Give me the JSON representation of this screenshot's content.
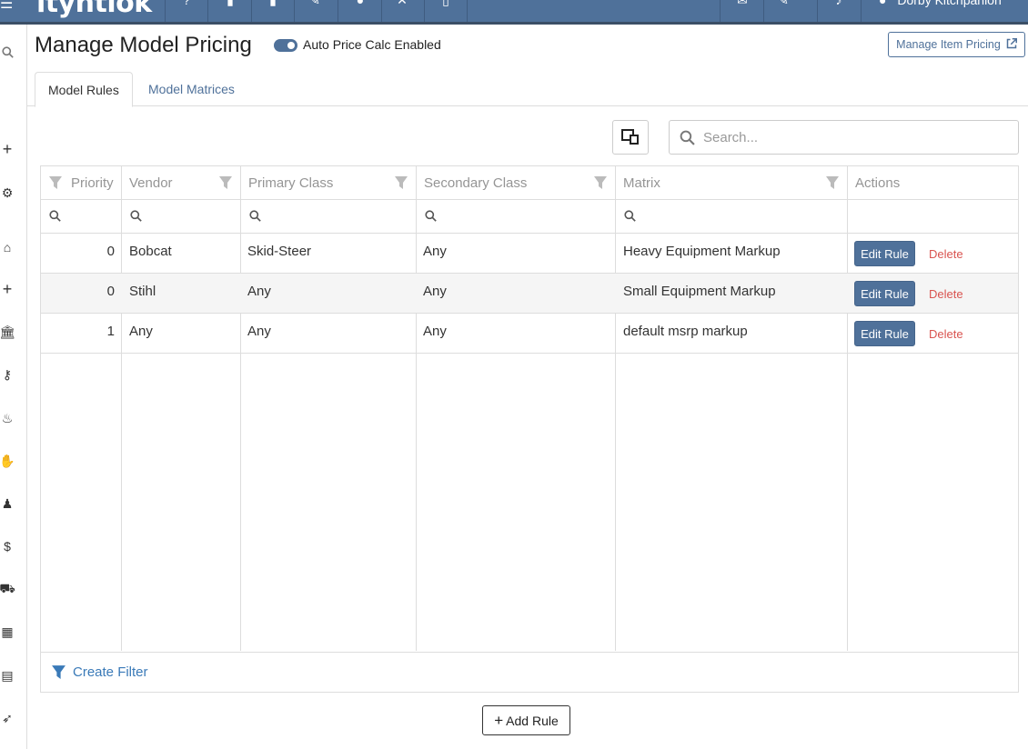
{
  "topbar": {
    "brand": "ityntlok",
    "user": "Dorby Kitchpanion",
    "icons": [
      "menu-icon",
      "help-icon",
      "clipboard-icon",
      "document-icon",
      "edit-doc-icon",
      "user-icon",
      "close-icon",
      "file-icon",
      "inbox-icon",
      "pencil-icon",
      "bell-icon",
      "person-icon"
    ]
  },
  "page": {
    "title": "Manage Model Pricing",
    "toggle_label": "Auto Price Calc Enabled",
    "toggle_on": true,
    "manage_item_pricing": "Manage Item Pricing"
  },
  "tabs": [
    {
      "label": "Model Rules",
      "active": true
    },
    {
      "label": "Model Matrices",
      "active": false
    }
  ],
  "search": {
    "placeholder": "Search...",
    "value": ""
  },
  "grid": {
    "columns": [
      "Priority",
      "Vendor",
      "Primary Class",
      "Secondary Class",
      "Matrix",
      "Actions"
    ],
    "rows": [
      {
        "priority": "0",
        "vendor": "Bobcat",
        "primary": "Skid-Steer",
        "secondary": "Any",
        "matrix": "Heavy Equipment Markup"
      },
      {
        "priority": "0",
        "vendor": "Stihl",
        "primary": "Any",
        "secondary": "Any",
        "matrix": "Small Equipment Markup"
      },
      {
        "priority": "1",
        "vendor": "Any",
        "primary": "Any",
        "secondary": "Any",
        "matrix": "default msrp markup"
      }
    ],
    "edit_label": "Edit Rule",
    "delete_label": "Delete",
    "create_filter": "Create Filter"
  },
  "add_rule": "Add Rule",
  "colors": {
    "primary": "#4f719a",
    "danger": "#d9534f",
    "link": "#3a7ab8"
  }
}
